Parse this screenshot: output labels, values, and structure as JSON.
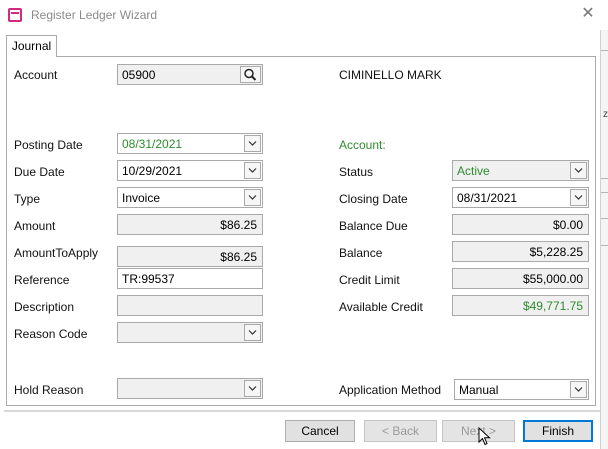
{
  "window": {
    "title": "Register Ledger Wizard"
  },
  "tabs": [
    {
      "label": "Journal"
    }
  ],
  "left": {
    "account_label": "Account",
    "account_value": "05900",
    "posting_date_label": "Posting Date",
    "posting_date": "08/31/2021",
    "due_date_label": "Due Date",
    "due_date": "10/29/2021",
    "type_label": "Type",
    "type": "Invoice",
    "amount_label": "Amount",
    "amount": "$86.25",
    "amount_to_apply_label": "AmountToApply",
    "amount_to_apply": "$86.25",
    "reference_label": "Reference",
    "reference": "TR:99537",
    "description_label": "Description",
    "description": "",
    "reason_code_label": "Reason Code",
    "reason_code": "",
    "hold_reason_label": "Hold Reason",
    "hold_reason": ""
  },
  "right": {
    "account_name": "CIMINELLO MARK",
    "account_section": "Account:",
    "status_label": "Status",
    "status": "Active",
    "closing_date_label": "Closing Date",
    "closing_date": "08/31/2021",
    "balance_due_label": "Balance Due",
    "balance_due": "$0.00",
    "balance_label": "Balance",
    "balance": "$5,228.25",
    "credit_limit_label": "Credit Limit",
    "credit_limit": "$55,000.00",
    "available_credit_label": "Available Credit",
    "available_credit": "$49,771.75",
    "application_method_label": "Application Method",
    "application_method": "Manual"
  },
  "buttons": {
    "cancel": "Cancel",
    "back": "< Back",
    "next": "Next >",
    "finish": "Finish"
  },
  "colors": {
    "accent_green": "#2f8a2f",
    "icon_pink": "#d12a7e",
    "focus_blue": "#0078d7"
  },
  "icons": [
    "app-icon",
    "close-icon",
    "search-icon",
    "chevron-down-icon",
    "mouse-cursor-icon"
  ]
}
